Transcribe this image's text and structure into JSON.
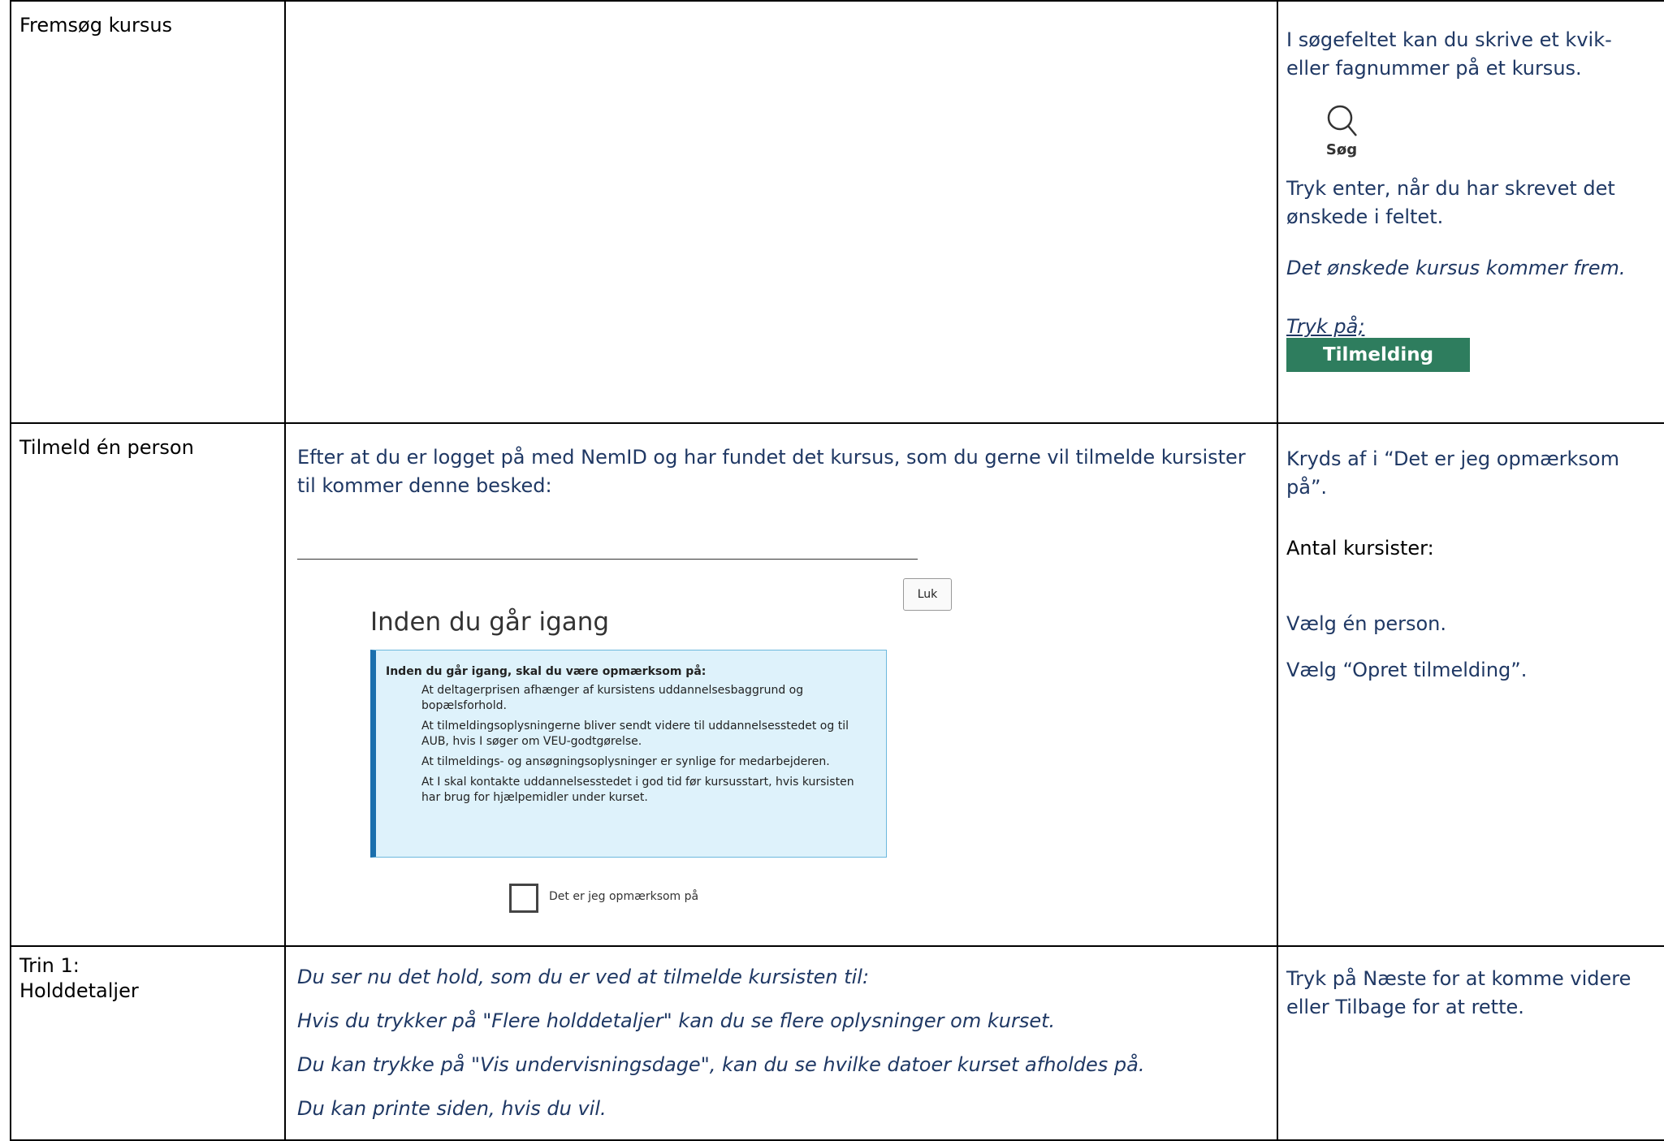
{
  "rows": [
    {
      "label": "Fremsøg kursus",
      "right": {
        "p1": "I søgefeltet kan du skrive et kvik- eller fagnummer på et kursus.",
        "search_label": "Søg",
        "p2": "Tryk enter, når du har skrevet det ønskede i feltet.",
        "p3": "Det ønskede kursus kommer frem.",
        "p4": "Tryk på;",
        "button": "Tilmelding"
      }
    },
    {
      "label": "Tilmeld én person",
      "middle": {
        "intro": "Efter at du er logget på med NemID og har fundet det kursus, som du gerne vil tilmelde kursister til kommer denne besked:",
        "dialog": {
          "close": "Luk",
          "title": "Inden du går igang",
          "info_head": "Inden du går igang, skal du være opmærksom på:",
          "items": [
            "At deltagerprisen afhænger af kursistens uddannelsesbaggrund og bopælsforhold.",
            "At tilmeldingsoplysningerne bliver sendt videre til uddannelsesstedet og til AUB, hvis I søger om VEU-godtgørelse.",
            "At tilmeldings- og ansøgningsoplysninger er synlige for medarbejderen.",
            "At I skal kontakte uddannelsesstedet i god tid før kursusstart, hvis kursisten har brug for hjælpemidler under kurset."
          ],
          "checkbox_label": "Det er jeg opmærksom på"
        }
      },
      "right": {
        "p1": "Kryds af i “Det er jeg opmærksom på”.",
        "p2": "Antal kursister:",
        "p3": "Vælg én person.",
        "p4": "Vælg “Opret tilmelding”."
      }
    },
    {
      "label_line1": "Trin 1:",
      "label_line2": "Holddetaljer",
      "middle": {
        "l1": "Du ser nu det hold, som du er ved at tilmelde kursisten til:",
        "l2": "Hvis du trykker på \"Flere holddetaljer\" kan du se flere oplysninger om kurset.",
        "l3": "Du kan trykke på \"Vis undervisningsdage\", kan du se hvilke datoer kurset afholdes på.",
        "l4": "Du kan printe siden, hvis du vil."
      },
      "right": {
        "p1": "Tryk på Næste for at komme videre eller Tilbage for at rette."
      }
    }
  ]
}
